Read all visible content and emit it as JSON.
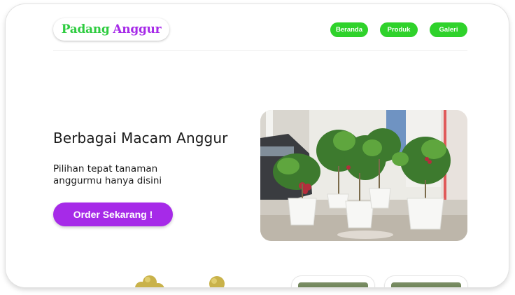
{
  "brand": {
    "word1": "Padang",
    "word2": "Anggur",
    "color1": "#2ecc40",
    "color2": "#a62ae8"
  },
  "nav": {
    "items": [
      {
        "label": "Beranda"
      },
      {
        "label": "Produk"
      },
      {
        "label": "Galeri"
      }
    ],
    "color": "#2fd22b"
  },
  "hero": {
    "title": "Berbagai Macam Anggur",
    "subtitle": "Pilihan tepat tanaman anggurmu hanya disini",
    "cta_label": "Order Sekarang !",
    "cta_color": "#a62ae8",
    "image_icon": "potted-grape-plants-photo"
  },
  "section2": {
    "decoration_icon": "grapes-icon",
    "cards": [
      {
        "image_icon": "grape-plant-thumbnail"
      },
      {
        "image_icon": "grape-plant-thumbnail"
      }
    ]
  }
}
